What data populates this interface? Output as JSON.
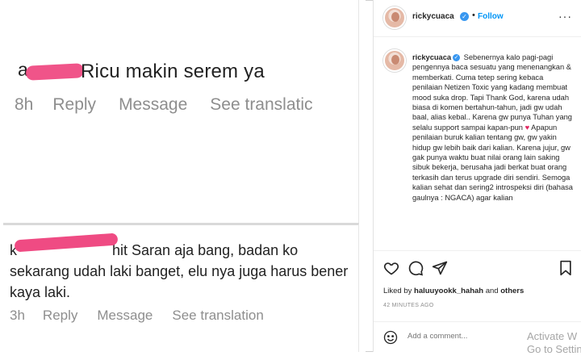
{
  "colors": {
    "accent": "#0095f6",
    "verified": "#3897f0",
    "redact": "#ef4b83",
    "muted": "#8e8e8e"
  },
  "comment1": {
    "user_partial": "a",
    "body": "Ricu makin serem ya",
    "time": "8h",
    "reply": "Reply",
    "message": "Message",
    "translate": "See translatic"
  },
  "comment2": {
    "user_prefix": "k",
    "user_suffix": "hit",
    "body": "Saran aja bang, badan ko sekarang udah laki banget, elu nya juga harus bener kaya laki.",
    "time": "3h",
    "reply": "Reply",
    "message": "Message",
    "translate": "See translation"
  },
  "post": {
    "username": "rickycuaca",
    "dot": "•",
    "follow": "Follow",
    "more": "···",
    "caption": "Sebenernya kalo pagi-pagi pengennya baca sesuatu yang menenangkan & memberkati. Cuma tetep sering kebaca penilaian Netizen Toxic yang kadang membuat mood suka drop. Tapi Thank God, karena udah biasa di komen bertahun-tahun, jadi gw udah baal, alias kebal.. Karena gw punya Tuhan yang selalu support sampai kapan-pun",
    "caption_heart": "♥",
    "caption_cont": " Apapun penilaian buruk kalian tentang gw, gw yakin hidup gw lebih baik dari kalian. Karena jujur, gw gak punya waktu buat nilai orang lain saking sibuk bekerja, berusaha jadi berkat buat orang terkasih dan terus upgrade diri sendiri. Semoga kalian sehat dan sering2 introspeksi diri (bahasa gaulnya : NGACA) agar kalian",
    "likes_prefix": "Liked by ",
    "likes_user": "haluuyookk_hahah",
    "likes_and": " and ",
    "likes_others": "others",
    "time_ago": "42 MINUTES AGO",
    "add_comment_placeholder": "Add a comment...",
    "watermark_line1": "Activate W",
    "watermark_line2": "Go to Settin"
  },
  "icons": [
    "heart-icon",
    "comment-icon",
    "share-icon",
    "bookmark-icon",
    "emoji-icon",
    "verified-icon"
  ]
}
